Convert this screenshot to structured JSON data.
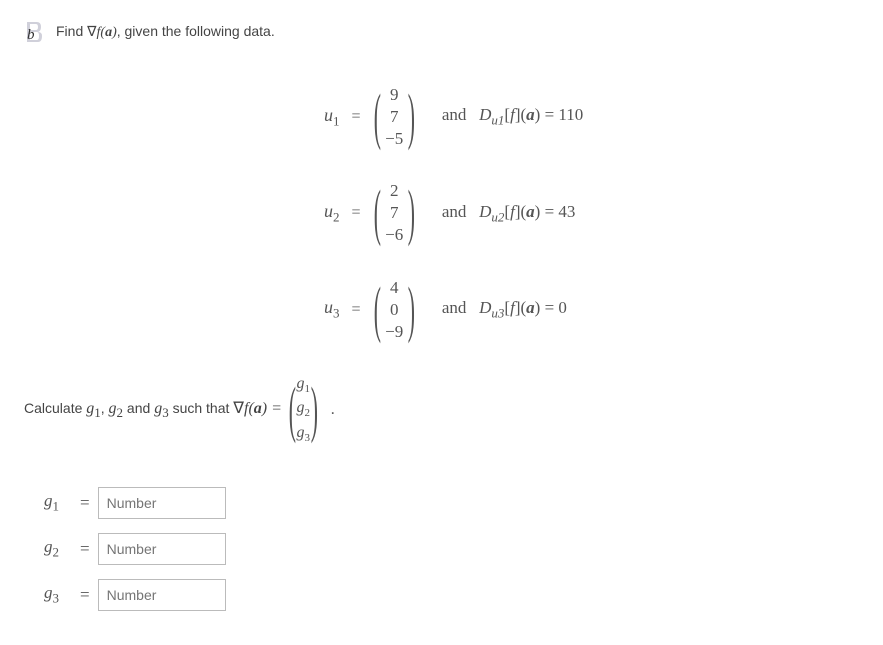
{
  "part_label": "b",
  "prompt_prefix": "Find ",
  "prompt_expr": "∇f(a)",
  "prompt_suffix": ", given the following data.",
  "equations": [
    {
      "u_label": "u",
      "u_sub": "1",
      "vec": [
        "9",
        "7",
        "−5"
      ],
      "and": "and",
      "d_prefix": "D",
      "d_sub": "u1",
      "d_mid": "[f](a) = ",
      "d_val": "110"
    },
    {
      "u_label": "u",
      "u_sub": "2",
      "vec": [
        "2",
        "7",
        "−6"
      ],
      "and": "and",
      "d_prefix": "D",
      "d_sub": "u2",
      "d_mid": "[f](a) = ",
      "d_val": "43"
    },
    {
      "u_label": "u",
      "u_sub": "3",
      "vec": [
        "4",
        "0",
        "−9"
      ],
      "and": "and",
      "d_prefix": "D",
      "d_sub": "u3",
      "d_mid": "[f](a) = ",
      "d_val": "0"
    }
  ],
  "calc_prefix": "Calculate ",
  "calc_g1": "g",
  "calc_g1s": "1",
  "calc_comma": ", ",
  "calc_g2": "g",
  "calc_g2s": "2",
  "calc_and": " and ",
  "calc_g3": "g",
  "calc_g3s": "3",
  "calc_such": " such that ",
  "calc_expr": "∇f(a) = ",
  "g_vec": [
    {
      "g": "g",
      "s": "1"
    },
    {
      "g": "g",
      "s": "2"
    },
    {
      "g": "g",
      "s": "3"
    }
  ],
  "inputs": [
    {
      "label": "g",
      "sub": "1",
      "placeholder": "Number"
    },
    {
      "label": "g",
      "sub": "2",
      "placeholder": "Number"
    },
    {
      "label": "g",
      "sub": "3",
      "placeholder": "Number"
    }
  ]
}
